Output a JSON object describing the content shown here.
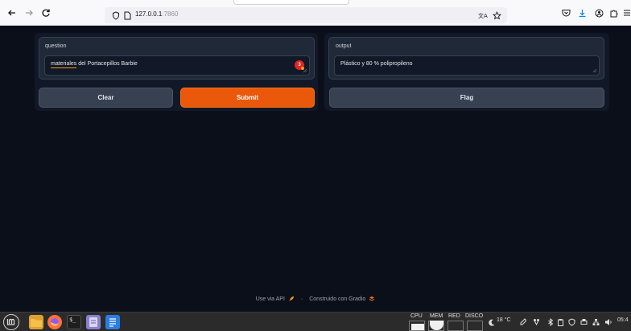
{
  "browser": {
    "url_host": "127.0.0.1",
    "url_port": ":7860"
  },
  "app": {
    "question": {
      "label": "question",
      "value_highlight": "materiales",
      "value_rest": " del Portacepillos Barbie",
      "badge_count": "3"
    },
    "output": {
      "label": "output",
      "value": "Plástico y 80 % polipropileno"
    },
    "buttons": {
      "clear": "Clear",
      "submit": "Submit",
      "flag": "Flag"
    },
    "footer": {
      "api": "Use via API",
      "separator": "·",
      "built_with": "Construido con Gradio"
    }
  },
  "taskbar": {
    "meters": [
      "CPU",
      "MEM",
      "RED",
      "DISCO"
    ],
    "temperature": "18 °C",
    "clock": "05:4",
    "terminal_glyph": "$_"
  },
  "colors": {
    "background": "#0b0f19",
    "panel": "#111827",
    "primary": "#ea580c",
    "secondary": "#374151"
  }
}
